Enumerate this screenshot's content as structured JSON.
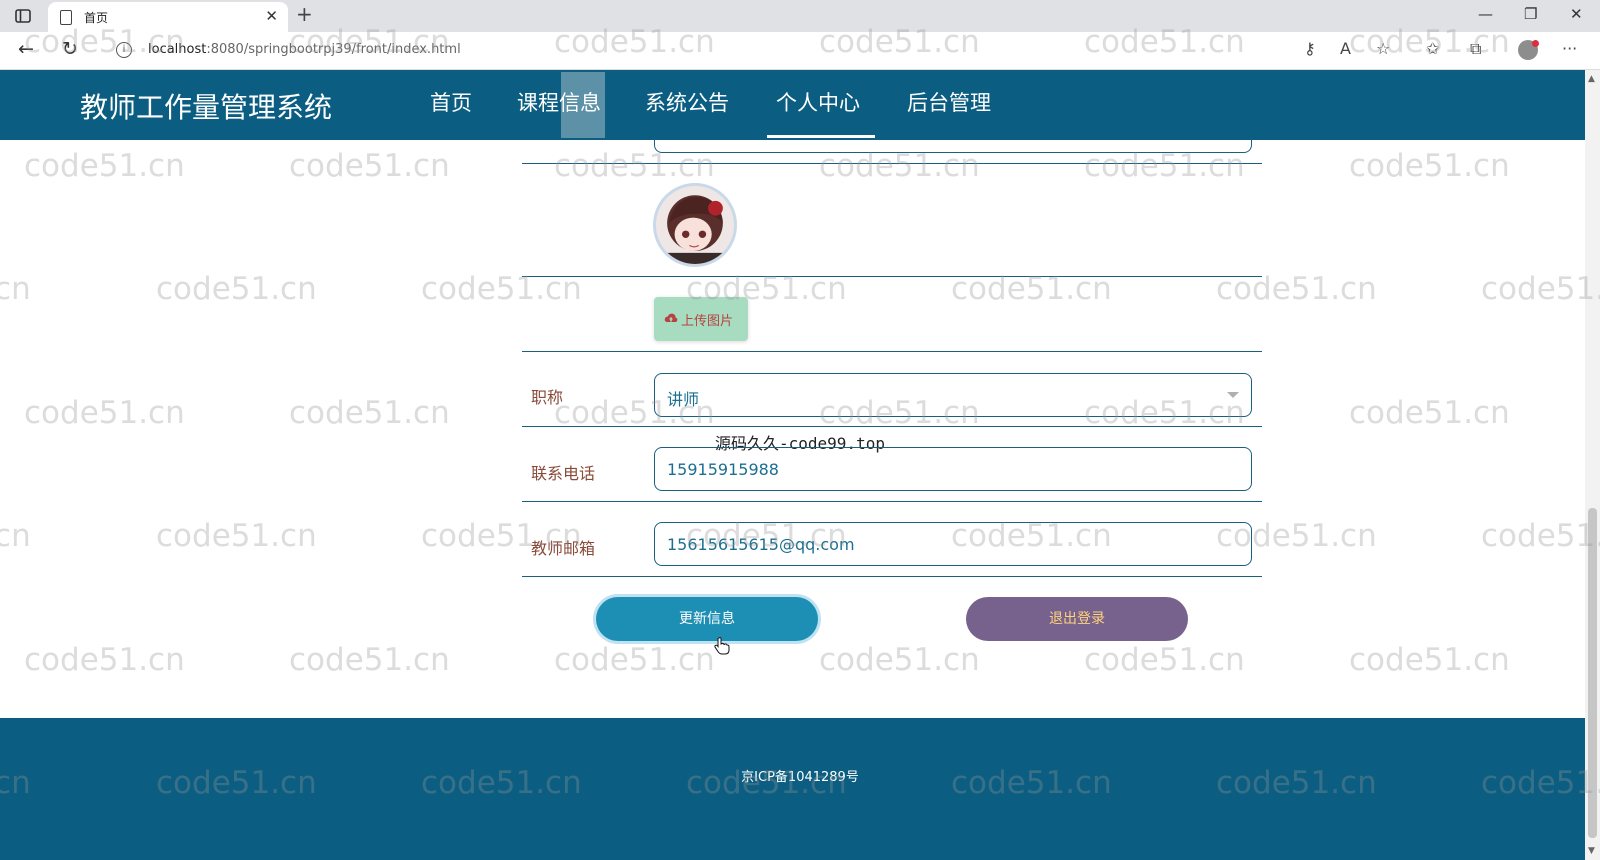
{
  "browser": {
    "tab_title": "首页",
    "url_host": "localhost",
    "url_rest": ":8080/springbootrpj39/front/index.html"
  },
  "site": {
    "title": "教师工作量管理系统",
    "nav": [
      "首页",
      "课程信息",
      "系统公告",
      "个人中心",
      "后台管理"
    ],
    "active_nav": "个人中心"
  },
  "form": {
    "upload_label": "上传图片",
    "title_label": "职称",
    "title_value": "讲师",
    "phone_label": "联系电话",
    "phone_value": "15915915988",
    "email_label": "教师邮箱",
    "email_value": "15615615615@qq.com",
    "update_button": "更新信息",
    "logout_button": "退出登录"
  },
  "overlay_text": "源码久久-code99.top",
  "footer": {
    "icp": "京ICP备1041289号"
  },
  "watermark": "code51.cn"
}
